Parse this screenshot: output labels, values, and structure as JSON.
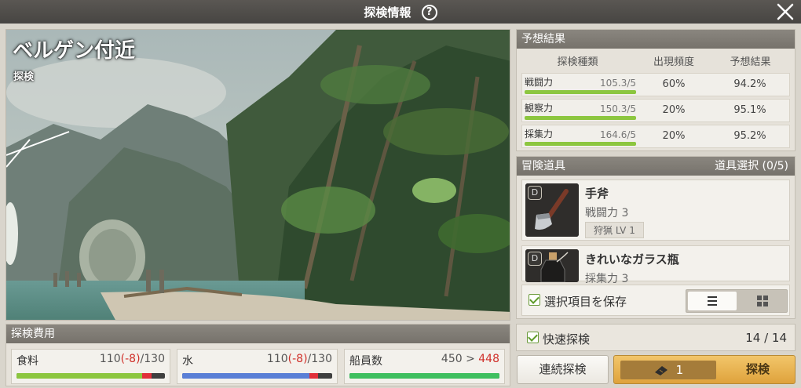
{
  "window": {
    "title": "探検情報",
    "help_glyph": "?"
  },
  "scene": {
    "location": "ベルゲン付近",
    "subtitle": "探検"
  },
  "prediction": {
    "header": "予想結果",
    "columns": [
      "探検種類",
      "出現頻度",
      "予想結果"
    ],
    "rows": [
      {
        "name": "戦闘力",
        "score": "105.3/5",
        "fill": 1.0,
        "rate": "60%",
        "result": "94.2%"
      },
      {
        "name": "観察力",
        "score": "150.3/5",
        "fill": 1.0,
        "rate": "20%",
        "result": "95.1%"
      },
      {
        "name": "採集力",
        "score": "164.6/5",
        "fill": 1.0,
        "rate": "20%",
        "result": "95.2%"
      }
    ]
  },
  "tools": {
    "header": "冒険道具",
    "select_label": "道具選択 (0/5)",
    "items": [
      {
        "badge": "D",
        "name": "手斧",
        "stat": "戦闘力 3",
        "tag": "狩猟 LV 1"
      },
      {
        "badge": "D",
        "name": "きれいなガラス瓶",
        "stat": "採集力 3"
      }
    ],
    "save_label": "選択項目を保存"
  },
  "cost": {
    "header": "探検費用",
    "items": [
      {
        "name": "食料",
        "current": "110",
        "delta": "(-8)",
        "max": "/130",
        "fill": 0.846,
        "loss": 0.062,
        "color": "#8cc63f"
      },
      {
        "name": "水",
        "current": "110",
        "delta": "(-8)",
        "max": "/130",
        "fill": 0.846,
        "loss": 0.062,
        "color": "#5a7fd6"
      },
      {
        "name": "船員数",
        "current": "450 > ",
        "next": "448",
        "fill": 1.0,
        "color": "#3fbf5f"
      }
    ]
  },
  "quick": {
    "label": "快速探検",
    "count": "14 / 14"
  },
  "buttons": {
    "continuous": "連続探検",
    "ticket_count": "1",
    "explore": "探検"
  },
  "colors": {
    "accent": "#e0a43e",
    "bar_green": "#8cc63f",
    "negative": "#d0302a"
  }
}
